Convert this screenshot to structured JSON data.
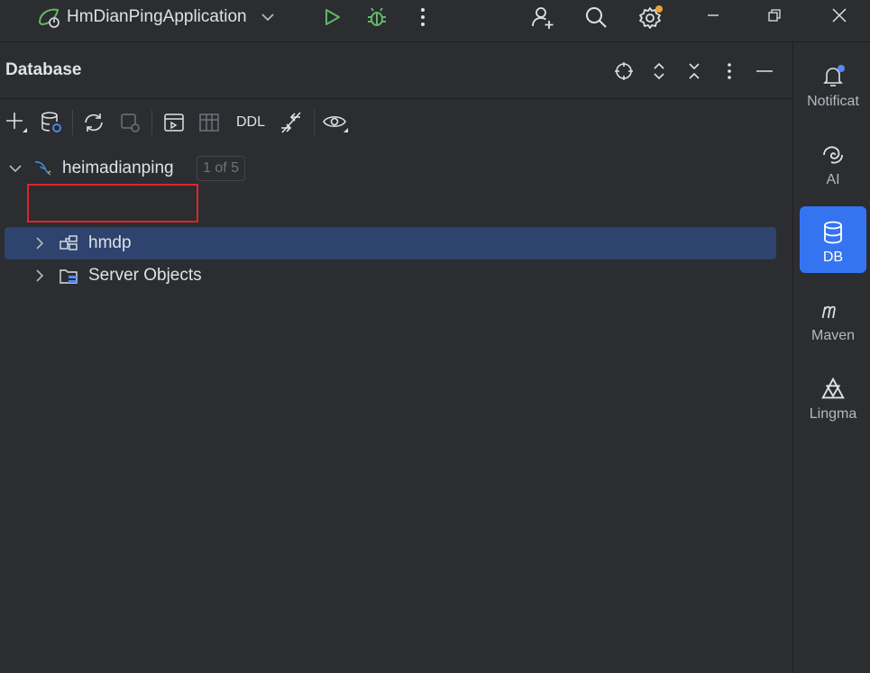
{
  "titlebar": {
    "run_config": "HmDianPingApplication",
    "icons": [
      "spring-app-icon",
      "chevron-down-icon",
      "run-icon",
      "debug-icon",
      "more-vertical-icon",
      "add-user-icon",
      "search-icon",
      "settings-icon",
      "minimize-icon",
      "restore-icon",
      "close-icon"
    ]
  },
  "panel": {
    "title": "Database",
    "toolbar": {
      "ddl_label": "DDL"
    }
  },
  "tree": {
    "datasource": {
      "label": "heimadianping",
      "badge": "1 of 5"
    },
    "schema": {
      "label": "hmdp"
    },
    "server_objects": {
      "label": "Server Objects"
    }
  },
  "sidebar": {
    "items": [
      {
        "label": "Notificat"
      },
      {
        "label": "AI"
      },
      {
        "label": "DB"
      },
      {
        "label": "Maven"
      },
      {
        "label": "Lingma"
      }
    ]
  },
  "colors": {
    "accent": "#3574f0",
    "selection": "#2e436e",
    "highlight": "#e0242a",
    "run": "#5fb865"
  }
}
